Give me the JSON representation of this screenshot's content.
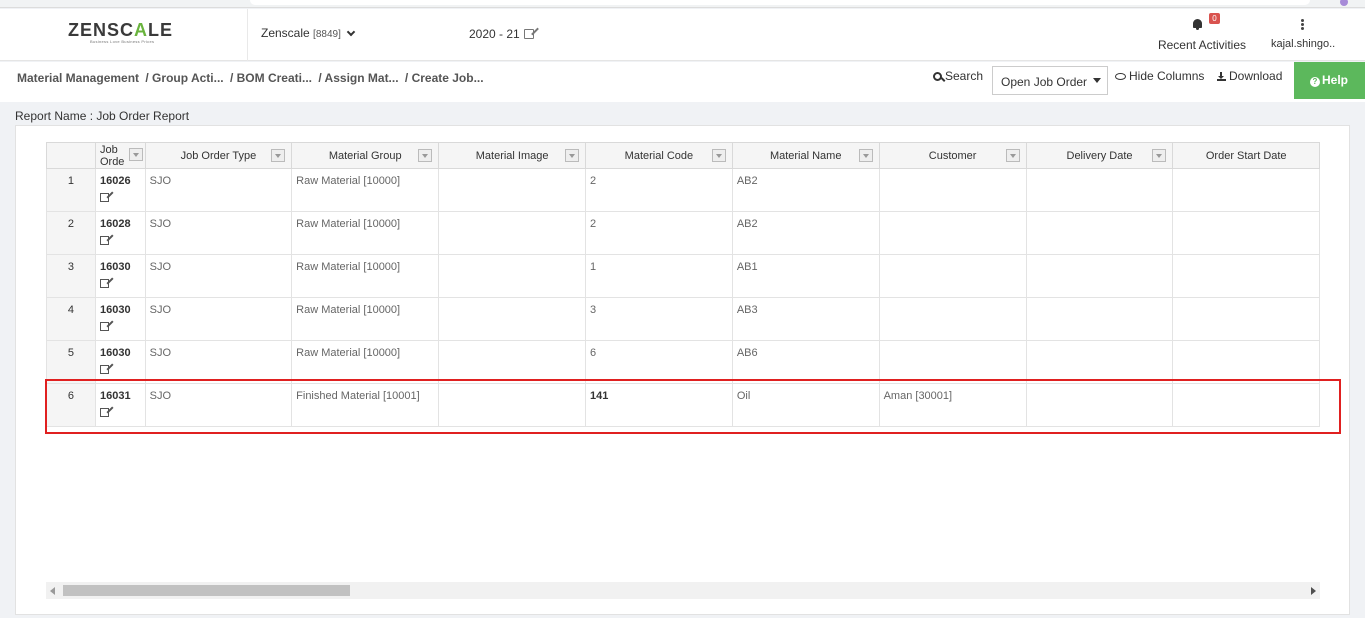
{
  "brand": {
    "logo_a": "ZENSC",
    "logo_b": "A",
    "logo_c": "LE",
    "tagline": "Business Love Business Prices"
  },
  "header": {
    "company": "Zenscale",
    "company_code": "[8849]",
    "year": "2020 - 21",
    "notifications_count": "0",
    "recent_label": "Recent Activities",
    "user": "kajal.shingo.."
  },
  "breadcrumb": [
    "Material Management",
    "/ Group Acti...",
    "/ BOM Creati...",
    "/ Assign Mat...",
    "/ Create Job..."
  ],
  "toolbar": {
    "search_label": "Search",
    "report_select": "Open Job Order",
    "hide_columns_label": "Hide Columns",
    "download_label": "Download",
    "help_label": "Help"
  },
  "report_name": "Report Name : Job Order Report",
  "table": {
    "columns": [
      "Job Orde",
      "Job Order Type",
      "Material Group",
      "Material Image",
      "Material Code",
      "Material Name",
      "Customer",
      "Delivery Date",
      "Order Start Date"
    ],
    "rows": [
      {
        "n": "1",
        "job": "16026",
        "type": "SJO",
        "group": "Raw Material [10000]",
        "image": "",
        "code": "2",
        "name": "AB2",
        "customer": "",
        "delivery": "",
        "start": ""
      },
      {
        "n": "2",
        "job": "16028",
        "type": "SJO",
        "group": "Raw Material [10000]",
        "image": "",
        "code": "2",
        "name": "AB2",
        "customer": "",
        "delivery": "",
        "start": ""
      },
      {
        "n": "3",
        "job": "16030",
        "type": "SJO",
        "group": "Raw Material [10000]",
        "image": "",
        "code": "1",
        "name": "AB1",
        "customer": "",
        "delivery": "",
        "start": ""
      },
      {
        "n": "4",
        "job": "16030",
        "type": "SJO",
        "group": "Raw Material [10000]",
        "image": "",
        "code": "3",
        "name": "AB3",
        "customer": "",
        "delivery": "",
        "start": ""
      },
      {
        "n": "5",
        "job": "16030",
        "type": "SJO",
        "group": "Raw Material [10000]",
        "image": "",
        "code": "6",
        "name": "AB6",
        "customer": "",
        "delivery": "",
        "start": ""
      },
      {
        "n": "6",
        "job": "16031",
        "type": "SJO",
        "group": "Finished Material [10001]",
        "image": "",
        "code": "141",
        "name": "Oil",
        "customer": "Aman [30001]",
        "delivery": "",
        "start": ""
      }
    ]
  },
  "colors": {
    "help": "#5cb85c",
    "highlight": "#e02020",
    "badge": "#d9534f",
    "brand_green": "#6ab43e"
  }
}
